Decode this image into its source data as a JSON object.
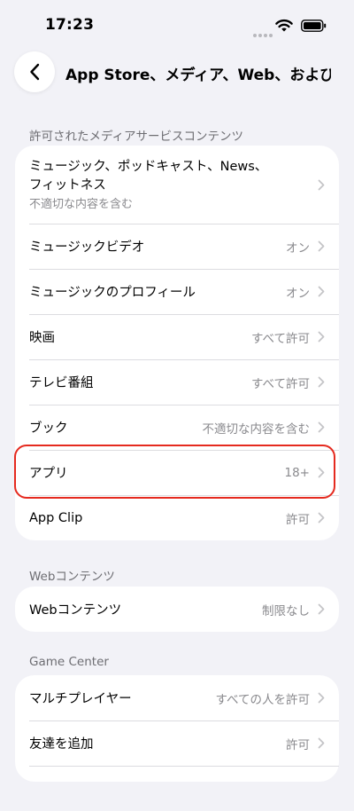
{
  "status": {
    "time": "17:23"
  },
  "nav": {
    "title": "App Store、メディア、Web、および…"
  },
  "sections": [
    {
      "header": "許可されたメディアサービスコンテンツ",
      "rows": [
        {
          "line1": "ミュージック、ポッドキャスト、News、",
          "line2": "フィットネス",
          "sub": "不適切な内容を含む"
        },
        {
          "label": "ミュージックビデオ",
          "value": "オン"
        },
        {
          "label": "ミュージックのプロフィール",
          "value": "オン"
        },
        {
          "label": "映画",
          "value": "すべて許可"
        },
        {
          "label": "テレビ番組",
          "value": "すべて許可"
        },
        {
          "label": "ブック",
          "value": "不適切な内容を含む"
        },
        {
          "label": "アプリ",
          "value": "18+"
        },
        {
          "label": "App Clip",
          "value": "許可"
        }
      ]
    },
    {
      "header": "Webコンテンツ",
      "rows": [
        {
          "label": "Webコンテンツ",
          "value": "制限なし"
        }
      ]
    },
    {
      "header": "Game Center",
      "rows": [
        {
          "label": "マルチプレイヤー",
          "value": "すべての人を許可"
        },
        {
          "label": "友達を追加",
          "value": "許可"
        }
      ]
    }
  ],
  "colors": {
    "highlight": "#e52a1f",
    "background": "#f2f2f7"
  }
}
